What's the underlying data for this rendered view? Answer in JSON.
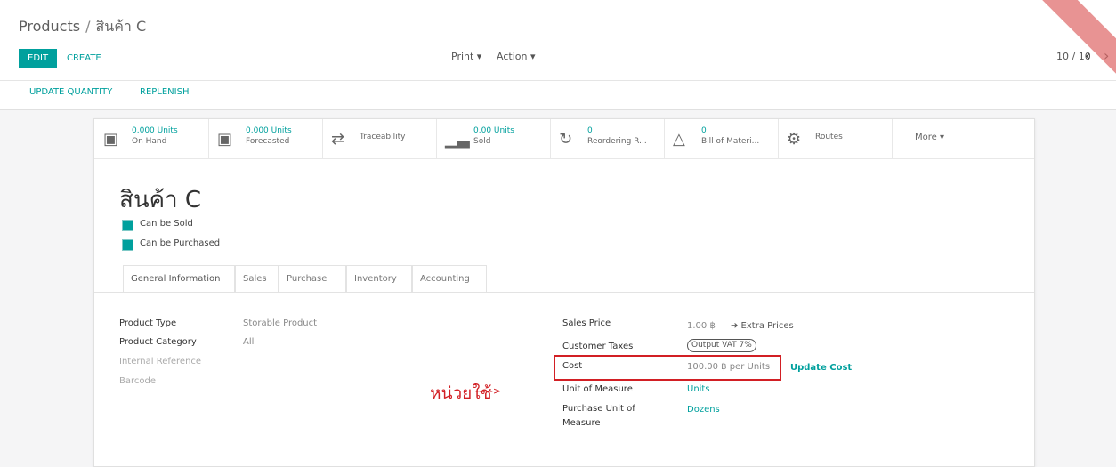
{
  "breadcrumb": {
    "parent": "Products",
    "separator": "/",
    "current": "สินค้า C"
  },
  "toolbar": {
    "edit_label": "EDIT",
    "create_label": "CREATE",
    "print_label": "Print ▾",
    "action_label": "Action ▾"
  },
  "pager": {
    "value": "10 / 10",
    "prev": "‹",
    "next": "›"
  },
  "statusbar": {
    "update_quantity": "UPDATE QUANTITY",
    "replenish": "REPLENISH"
  },
  "smart_buttons": [
    {
      "value": "0.000 Units",
      "label": "On Hand",
      "icon": "cubes-icon"
    },
    {
      "value": "0.000 Units",
      "label": "Forecasted",
      "icon": "cubes-icon"
    },
    {
      "value": "",
      "label": "Traceability",
      "icon": "exchange-icon"
    },
    {
      "value": "0.00 Units",
      "label": "Sold",
      "icon": "bar-chart-icon"
    },
    {
      "value": "0",
      "label": "Reordering R...",
      "icon": "refresh-icon"
    },
    {
      "value": "0",
      "label": "Bill of Materi...",
      "icon": "flask-icon"
    },
    {
      "value": "",
      "label": "Routes",
      "icon": "cogs-icon"
    }
  ],
  "more_label": "More ▾",
  "product": {
    "name": "สินค้า C",
    "can_be_sold": "Can be Sold",
    "can_be_purchased": "Can be Purchased"
  },
  "tabs": [
    "General Information",
    "Sales",
    "Purchase",
    "Inventory",
    "Accounting"
  ],
  "left_fields": {
    "product_type_label": "Product Type",
    "product_type_value": "Storable Product",
    "category_label": "Product Category",
    "category_value": "All",
    "internal_ref_label": "Internal Reference",
    "barcode_label": "Barcode"
  },
  "right_fields": {
    "sales_price_label": "Sales Price",
    "sales_price_value": "1.00 ฿",
    "extra_prices": "➔ Extra Prices",
    "customer_taxes_label": "Customer Taxes",
    "customer_taxes_value": "Output VAT 7%",
    "cost_label": "Cost",
    "cost_value": "100.00 ฿ per Units",
    "update_cost": "Update Cost",
    "uom_label": "Unit of Measure",
    "uom_value": "Units",
    "purchase_uom_label": "Purchase Unit of",
    "purchase_uom_label2": "Measure",
    "purchase_uom_value": "Dozens"
  },
  "annotation": {
    "text": "หน่วยใช้",
    "arrow": "----->"
  },
  "colors": {
    "accent": "#00a09d",
    "annotation": "#d21f24"
  }
}
